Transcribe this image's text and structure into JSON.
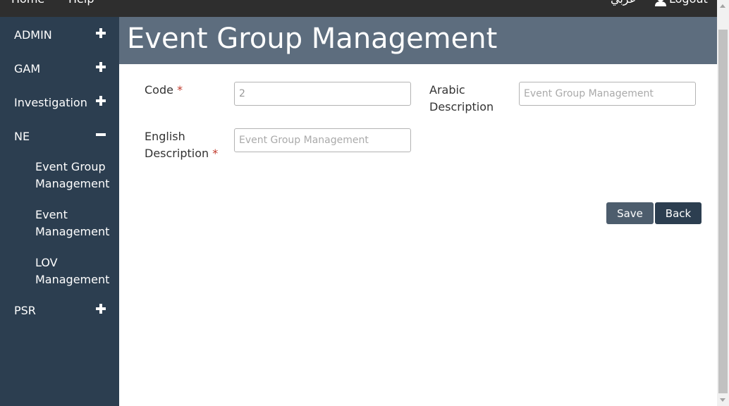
{
  "topnav": {
    "home": "Home",
    "help": "Help",
    "language": "عربي",
    "logout": "Logout"
  },
  "sidebar": {
    "items": [
      {
        "label": "ADMIN",
        "expanded": false
      },
      {
        "label": "GAM",
        "expanded": false
      },
      {
        "label": "Investigation",
        "expanded": false
      },
      {
        "label": "NE",
        "expanded": true
      },
      {
        "label": "PSR",
        "expanded": false
      }
    ],
    "ne_children": [
      {
        "line1": "Event Group",
        "line2": "Management"
      },
      {
        "line1": "Event",
        "line2": "Management"
      },
      {
        "line1": "LOV",
        "line2": "Management"
      }
    ]
  },
  "header": {
    "title": "Event Group Management"
  },
  "form": {
    "code": {
      "label": "Code",
      "required": "*",
      "value": "2"
    },
    "arabic": {
      "label_line1": "Arabic",
      "label_line2": "Description",
      "placeholder": "Event Group Management"
    },
    "english": {
      "label_line1": "English",
      "label_line2": "Description",
      "required": "*",
      "placeholder": "Event Group Management"
    }
  },
  "actions": {
    "save": "Save",
    "back": "Back"
  },
  "colors": {
    "topbar": "#2e2e2e",
    "sidebar": "#2c3e50",
    "header": "#5d6d7e",
    "required": "#c0392b",
    "save_button": "#4d5d6d",
    "back_button": "#2c3e50"
  }
}
